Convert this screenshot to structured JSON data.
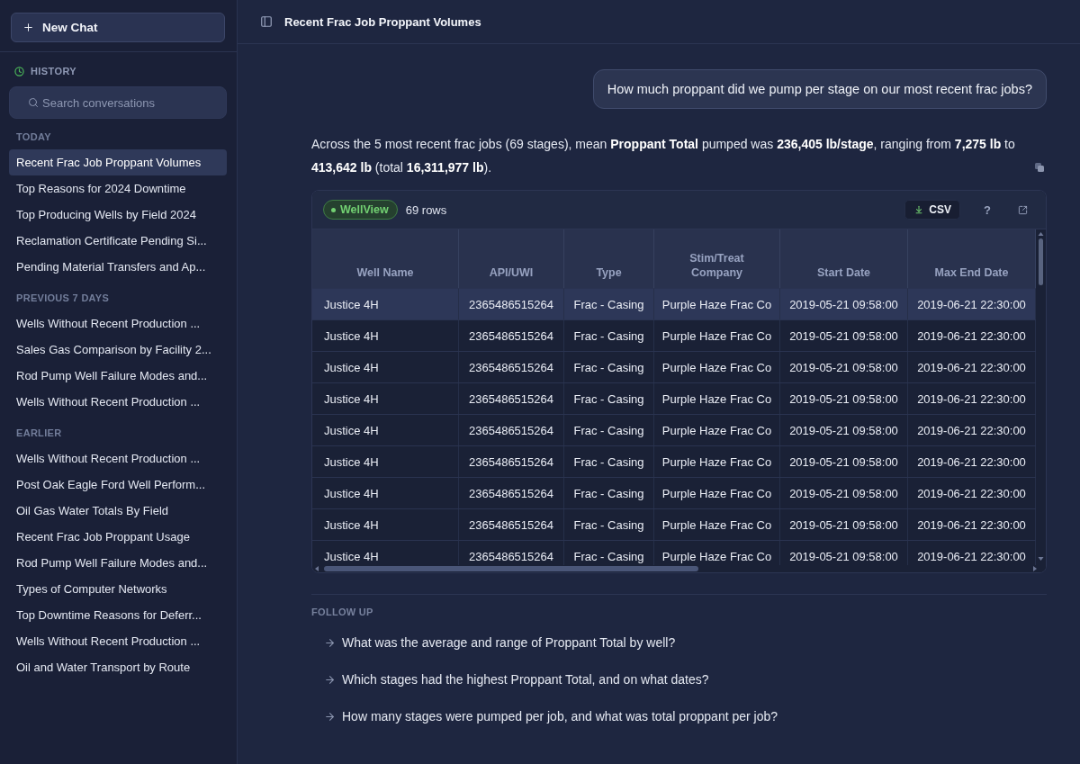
{
  "sidebar": {
    "new_chat_button": "New Chat",
    "history_label": "HISTORY",
    "search": {
      "placeholder": "Search conversations"
    },
    "sections": [
      {
        "title": "TODAY",
        "items": [
          {
            "label": "Recent Frac Job Proppant Volumes",
            "selected": true
          },
          {
            "label": "Top Reasons for 2024 Downtime",
            "selected": false
          },
          {
            "label": "Top Producing Wells by Field 2024",
            "selected": false
          },
          {
            "label": "Reclamation Certificate Pending Si...",
            "selected": false
          },
          {
            "label": "Pending Material Transfers and Ap...",
            "selected": false
          }
        ]
      },
      {
        "title": "PREVIOUS 7 DAYS",
        "items": [
          {
            "label": "Wells Without Recent Production ...",
            "selected": false
          },
          {
            "label": "Sales Gas Comparison by Facility 2...",
            "selected": false
          },
          {
            "label": "Rod Pump Well Failure Modes and...",
            "selected": false
          },
          {
            "label": "Wells Without Recent Production ...",
            "selected": false
          }
        ]
      },
      {
        "title": "EARLIER",
        "items": [
          {
            "label": "Wells Without Recent Production ...",
            "selected": false
          },
          {
            "label": "Post Oak Eagle Ford Well Perform...",
            "selected": false
          },
          {
            "label": "Oil Gas Water Totals By Field",
            "selected": false
          },
          {
            "label": "Recent Frac Job Proppant Usage",
            "selected": false
          },
          {
            "label": "Rod Pump Well Failure Modes and...",
            "selected": false
          },
          {
            "label": "Types of Computer Networks",
            "selected": false
          },
          {
            "label": "Top Downtime Reasons for Deferr...",
            "selected": false
          },
          {
            "label": "Wells Without Recent Production ...",
            "selected": false
          },
          {
            "label": "Oil and Water Transport by Route",
            "selected": false
          }
        ]
      }
    ]
  },
  "header": {
    "title": "Recent Frac Job Proppant Volumes"
  },
  "conversation": {
    "user_message": "How much proppant did we pump per stage on our most recent frac jobs?",
    "answer": "Across the 5 most recent frac jobs (69 stages), mean **Proppant Total** pumped was **236,405 lb/stage**, ranging from **7,275 lb** to **413,642 lb** (total **16,311,977 lb**).",
    "result_table": {
      "source_badge": "WellView",
      "row_count": "69 rows",
      "csv_button": "CSV",
      "help_button": "?",
      "columns": [
        "Well Name",
        "API/UWI",
        "Type",
        "Stim/Treat Company",
        "Start Date",
        "Max End Date"
      ],
      "rows": [
        {
          "selected": true,
          "cells": [
            "Justice 4H",
            "2365486515264",
            "Frac - Casing",
            "Purple Haze Frac Co",
            "2019-05-21 09:58:00",
            "2019-06-21 22:30:00"
          ]
        },
        {
          "selected": false,
          "cells": [
            "Justice 4H",
            "2365486515264",
            "Frac - Casing",
            "Purple Haze Frac Co",
            "2019-05-21 09:58:00",
            "2019-06-21 22:30:00"
          ]
        },
        {
          "selected": false,
          "cells": [
            "Justice 4H",
            "2365486515264",
            "Frac - Casing",
            "Purple Haze Frac Co",
            "2019-05-21 09:58:00",
            "2019-06-21 22:30:00"
          ]
        },
        {
          "selected": false,
          "cells": [
            "Justice 4H",
            "2365486515264",
            "Frac - Casing",
            "Purple Haze Frac Co",
            "2019-05-21 09:58:00",
            "2019-06-21 22:30:00"
          ]
        },
        {
          "selected": false,
          "cells": [
            "Justice 4H",
            "2365486515264",
            "Frac - Casing",
            "Purple Haze Frac Co",
            "2019-05-21 09:58:00",
            "2019-06-21 22:30:00"
          ]
        },
        {
          "selected": false,
          "cells": [
            "Justice 4H",
            "2365486515264",
            "Frac - Casing",
            "Purple Haze Frac Co",
            "2019-05-21 09:58:00",
            "2019-06-21 22:30:00"
          ]
        },
        {
          "selected": false,
          "cells": [
            "Justice 4H",
            "2365486515264",
            "Frac - Casing",
            "Purple Haze Frac Co",
            "2019-05-21 09:58:00",
            "2019-06-21 22:30:00"
          ]
        },
        {
          "selected": false,
          "cells": [
            "Justice 4H",
            "2365486515264",
            "Frac - Casing",
            "Purple Haze Frac Co",
            "2019-05-21 09:58:00",
            "2019-06-21 22:30:00"
          ]
        },
        {
          "selected": false,
          "cells": [
            "Justice 4H",
            "2365486515264",
            "Frac - Casing",
            "Purple Haze Frac Co",
            "2019-05-21 09:58:00",
            "2019-06-21 22:30:00"
          ]
        }
      ]
    },
    "follow_up": {
      "title": "FOLLOW UP",
      "items": [
        "What was the average and range of Proppant Total by well?",
        "Which stages had the highest Proppant Total, and on what dates?",
        "How many stages were pumped per job, and what was total proppant per job?"
      ]
    }
  }
}
